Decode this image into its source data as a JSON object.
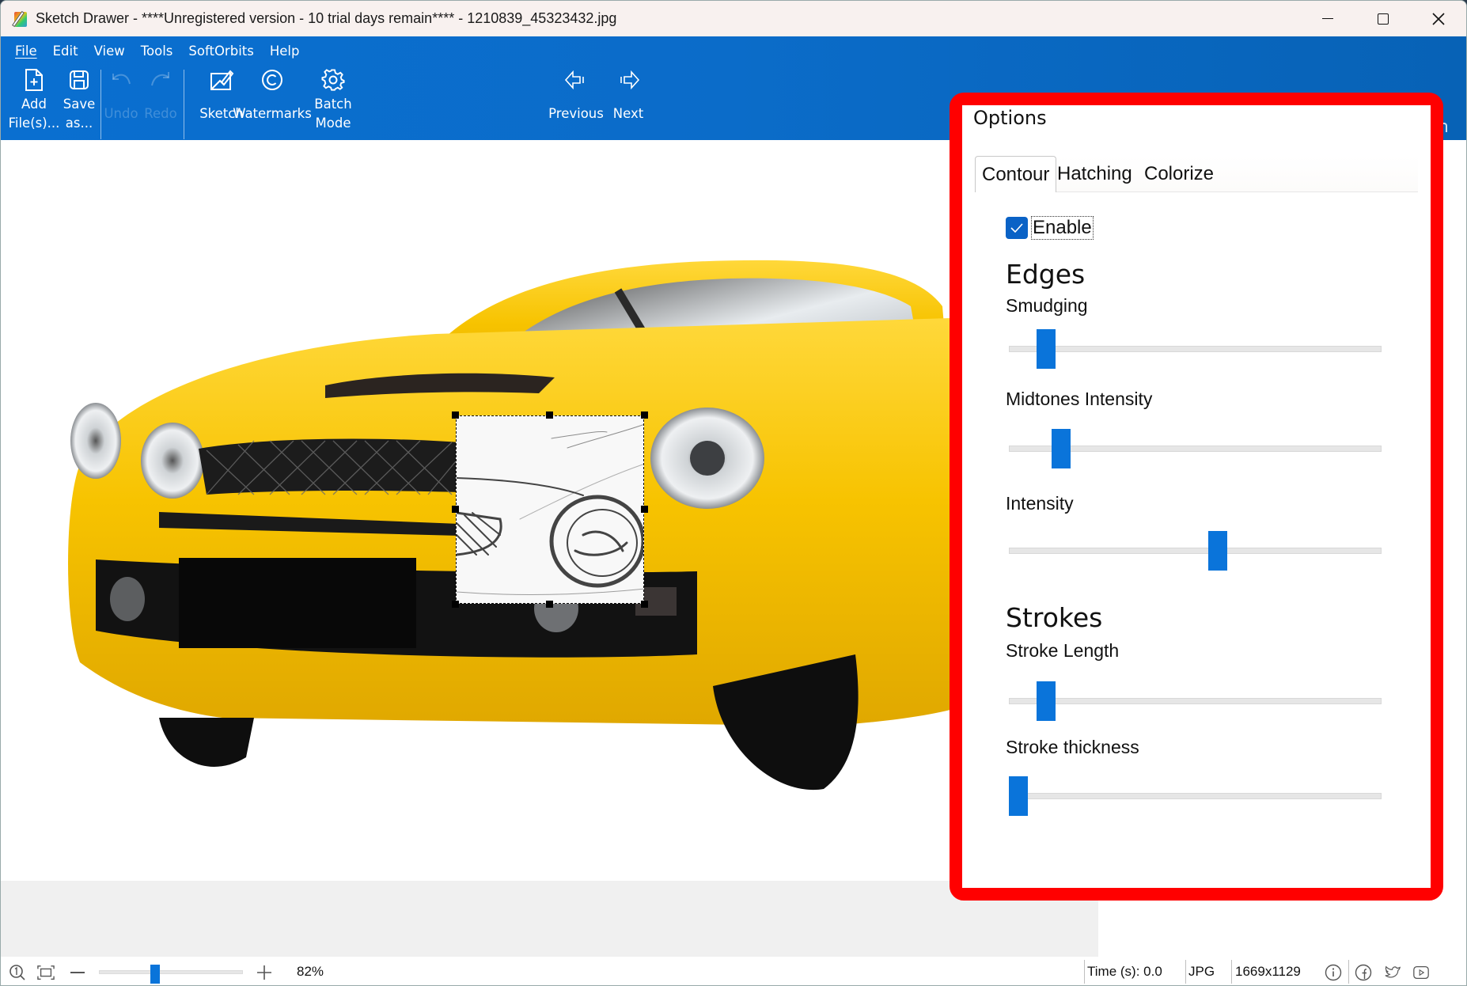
{
  "window": {
    "title": "Sketch Drawer - ****Unregistered version - 10 trial days remain**** - 1210839_45323432.jpg",
    "controls": {
      "minimize": "—",
      "maximize": "☐",
      "close": "✕"
    }
  },
  "menu": [
    {
      "label": "File"
    },
    {
      "label": "Edit"
    },
    {
      "label": "View"
    },
    {
      "label": "Tools"
    },
    {
      "label": "SoftOrbits"
    },
    {
      "label": "Help"
    }
  ],
  "toolbar": {
    "add_files": {
      "line1": "Add",
      "line2": "File(s)...",
      "icon": "add-file-icon"
    },
    "save_as": {
      "line1": "Save",
      "line2": "as...",
      "icon": "save-icon"
    },
    "undo": {
      "label": "Undo",
      "icon": "undo-icon",
      "enabled": false
    },
    "redo": {
      "label": "Redo",
      "icon": "redo-icon",
      "enabled": false
    },
    "sketch": {
      "label": "Sketch",
      "icon": "sketch-icon"
    },
    "watermarks": {
      "label": "Watermarks",
      "icon": "copyright-icon"
    },
    "batch_mode": {
      "line1": "Batch",
      "line2": "Mode",
      "icon": "gear-icon"
    },
    "previous": {
      "label": "Previous",
      "icon": "arrow-left-icon"
    },
    "next": {
      "label": "Next",
      "icon": "arrow-right-icon"
    }
  },
  "options": {
    "title": "Options",
    "tabs": [
      {
        "label": "Contour",
        "active": true
      },
      {
        "label": "Hatching",
        "active": false
      },
      {
        "label": "Colorize",
        "active": false
      }
    ],
    "enable": {
      "label": "Enable",
      "checked": true
    },
    "sections": {
      "edges": "Edges",
      "strokes": "Strokes"
    },
    "sliders": {
      "smudging": {
        "label": "Smudging",
        "value_fraction": 0.1
      },
      "midtones_intensity": {
        "label": "Midtones Intensity",
        "value_fraction": 0.14
      },
      "intensity": {
        "label": "Intensity",
        "value_fraction": 0.56
      },
      "stroke_length": {
        "label": "Stroke Length",
        "value_fraction": 0.1
      },
      "stroke_thickness": {
        "label": "Stroke thickness",
        "value_fraction": 0.02
      }
    },
    "highlight_color": "#ff0000"
  },
  "canvas": {
    "image_description": "Yellow sports car front view with a sketch-effect preview region over the headlight",
    "preview_selection": true
  },
  "statusbar": {
    "zoom_percent": "82%",
    "zoom_fraction": 0.38,
    "time": "Time (s): 0.0",
    "format": "JPG",
    "dimensions": "1669x1129"
  },
  "colors": {
    "ribbon_blue": "#0a6fd0",
    "accent_blue": "#0a74da",
    "annotation_red": "#ff0000",
    "car_yellow": "#f5c400"
  }
}
